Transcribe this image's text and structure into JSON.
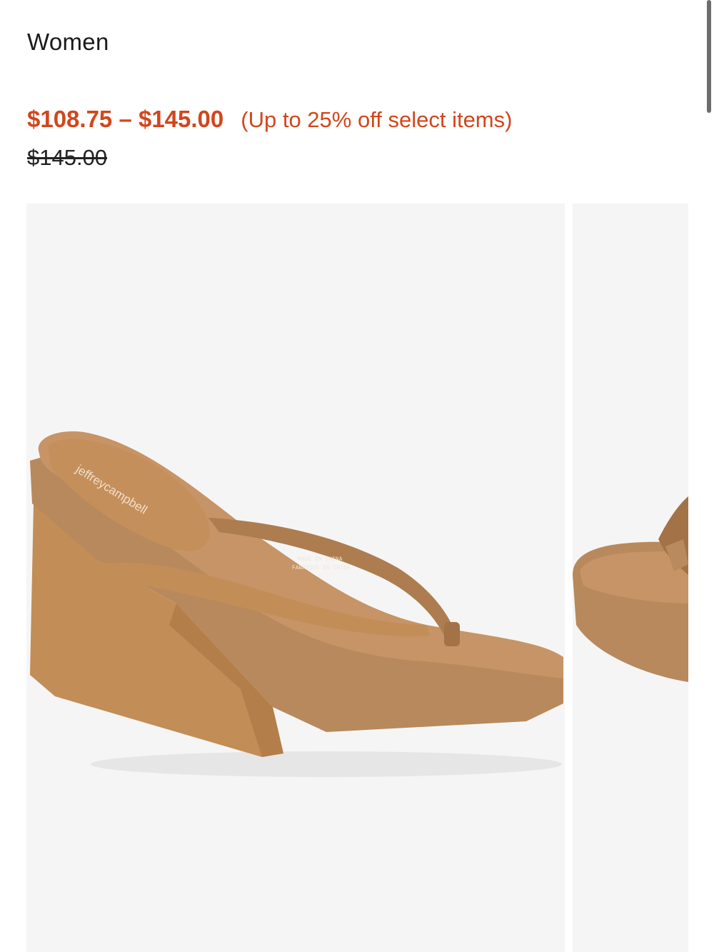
{
  "product": {
    "category": "Women",
    "sale_price": "$108.75 – $145.00",
    "discount_note": "(Up to 25% off select items)",
    "original_price": "$145.00",
    "brand_imprint": "jeffreycampbell"
  },
  "gallery": {
    "background_color": "#f5f5f5",
    "accent_color": "#d2461c",
    "shoe_colors": {
      "suede": "#c38d57",
      "leather": "#b48a5f",
      "insole": "#c9956a"
    }
  }
}
